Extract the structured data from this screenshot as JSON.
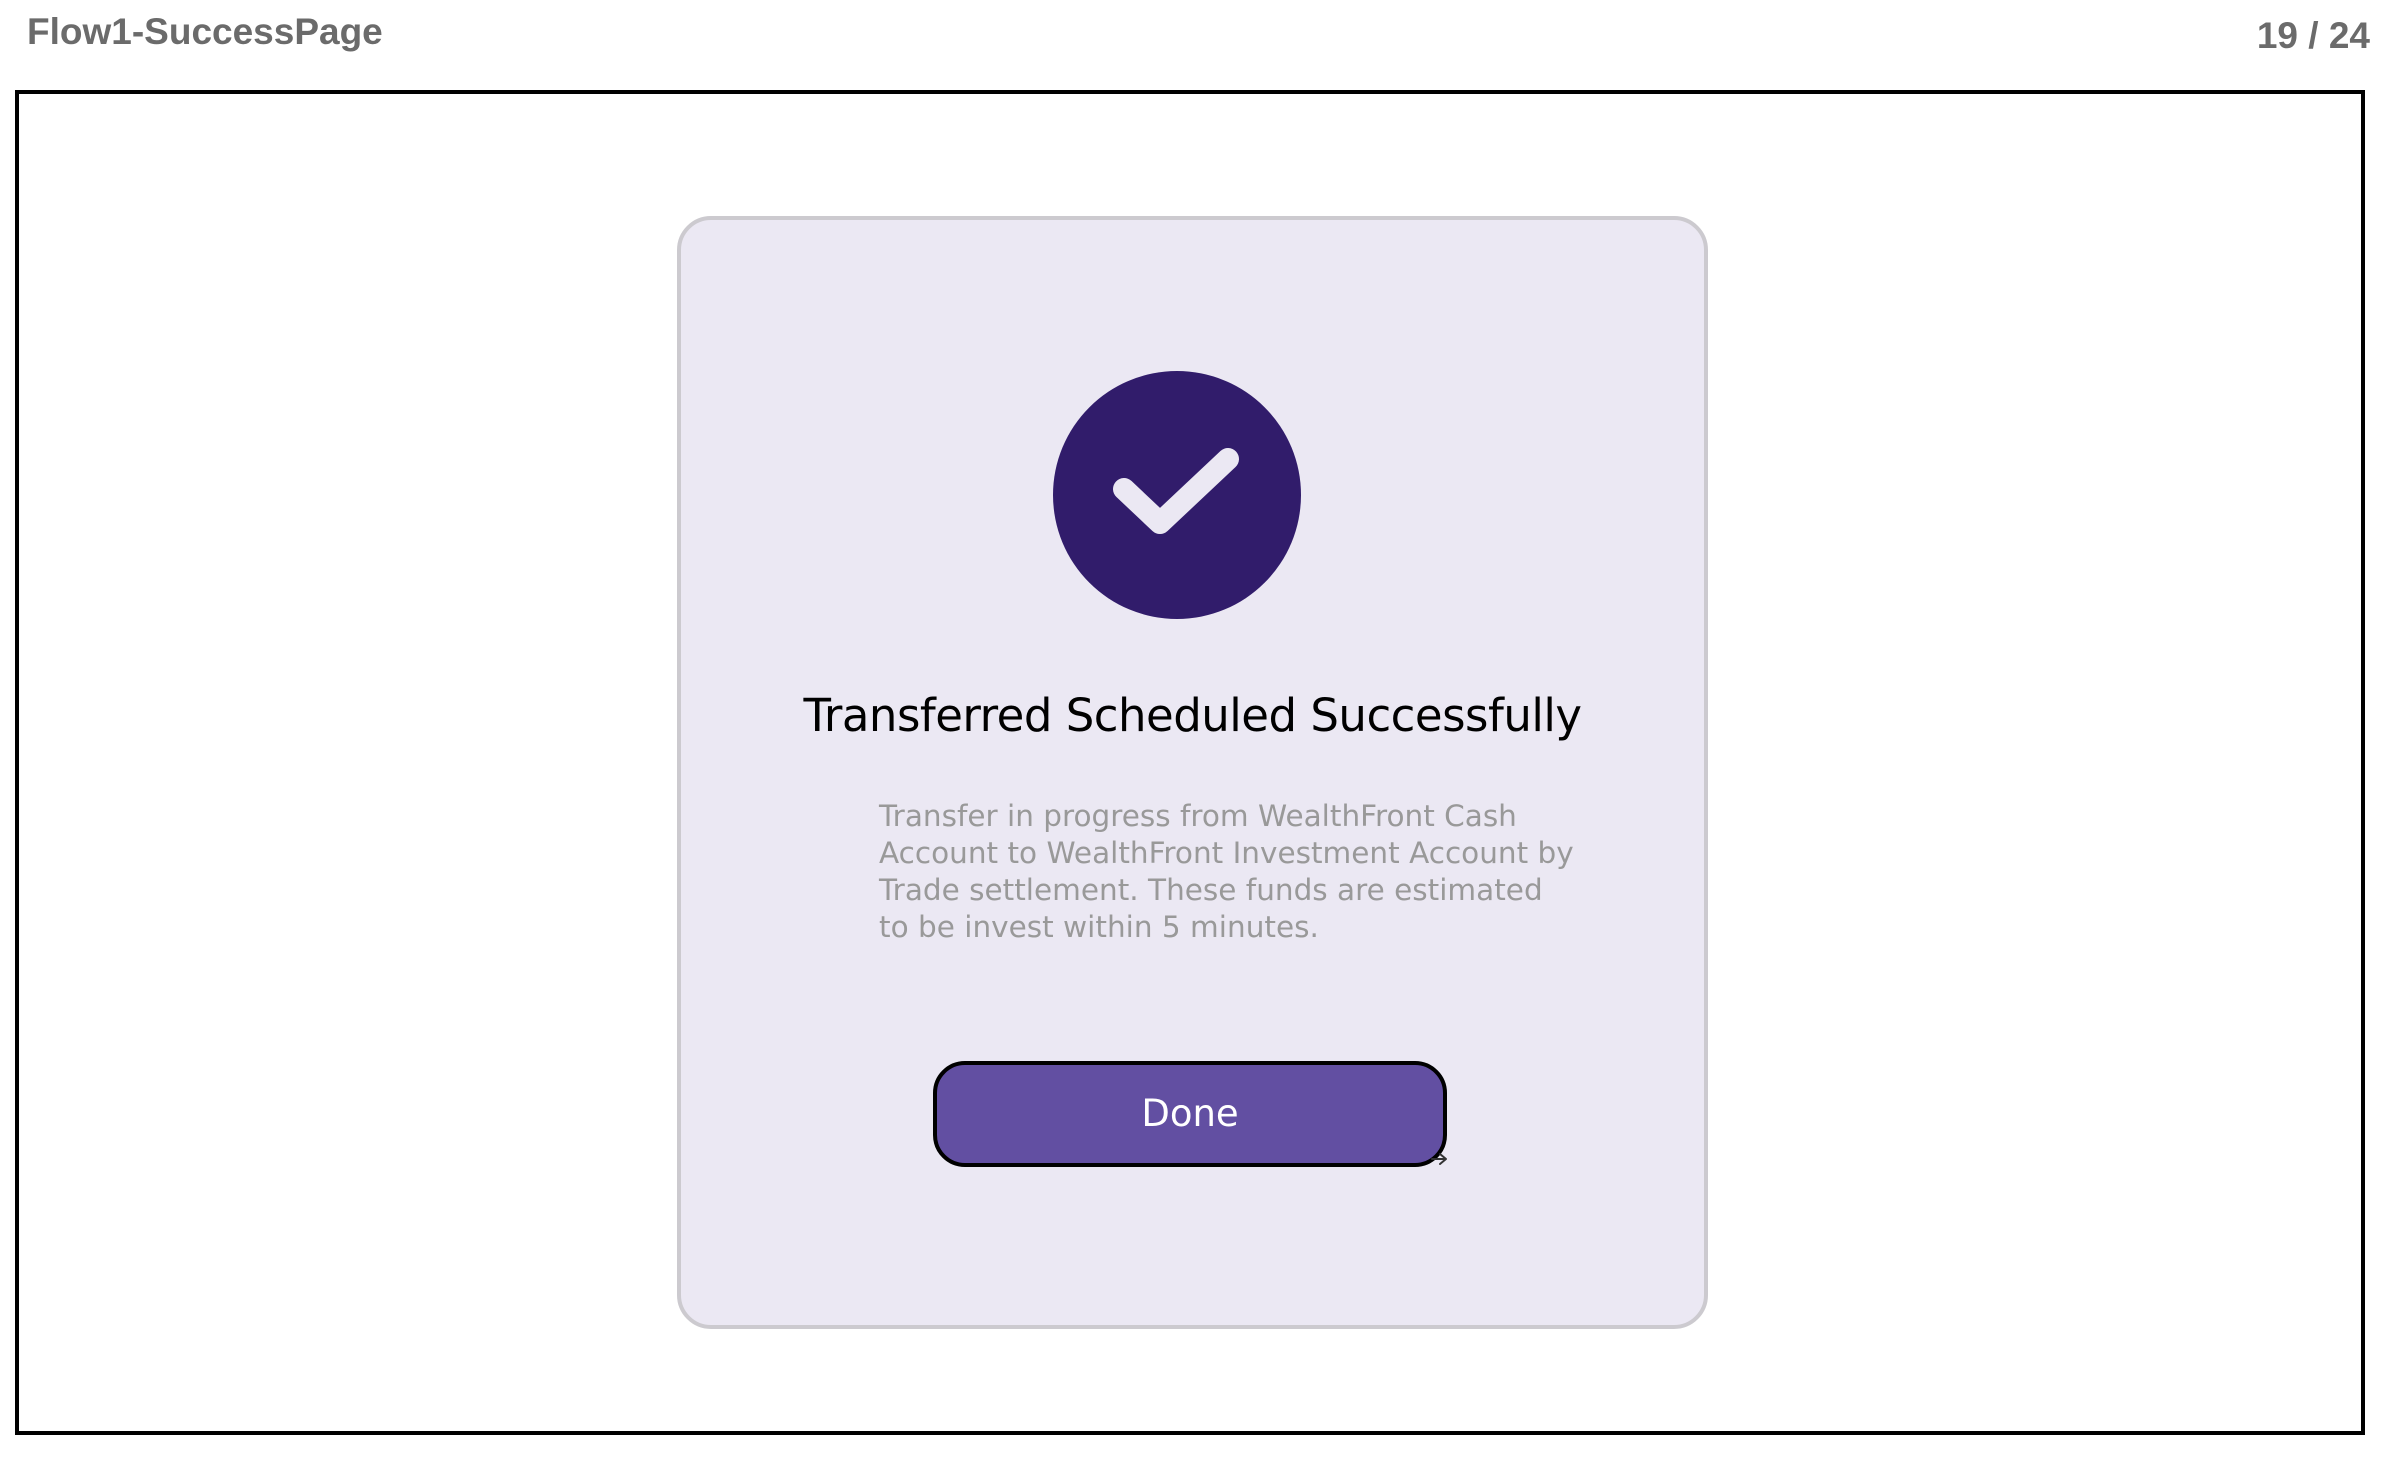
{
  "header": {
    "title": "Flow1-SuccessPage",
    "page_counter": "19 / 24"
  },
  "dialog": {
    "icon": "check-circle-icon",
    "title": "Transferred Scheduled Successfully",
    "message": "Transfer in progress from WealthFront Cash Account to WealthFront Investment Account by Trade settlement. These funds are estimated to be invest within 5 minutes.",
    "done_label": "Done"
  },
  "colors": {
    "card_background": "#ebe8f3",
    "icon_circle": "#311c6b",
    "button": "#624fa2",
    "message_text": "#999999"
  }
}
